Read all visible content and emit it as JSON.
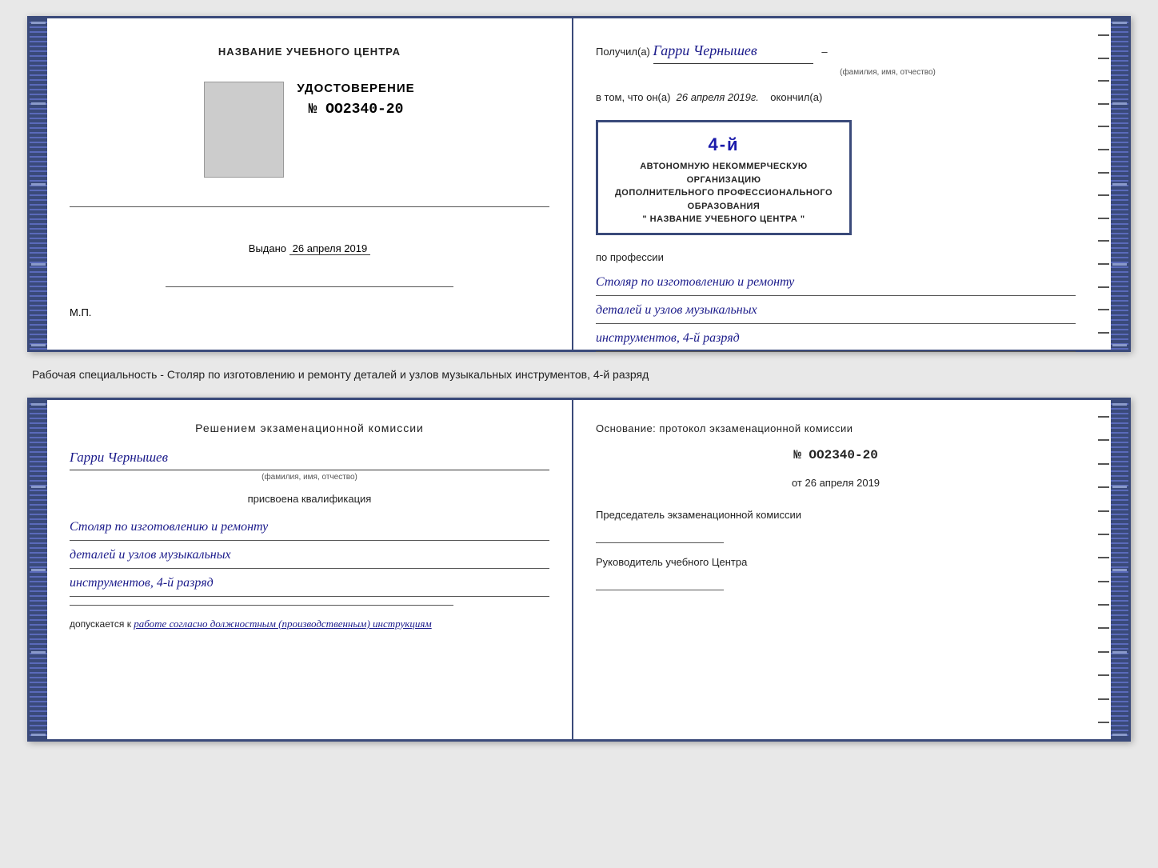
{
  "top_left": {
    "center_title": "НАЗВАНИЕ УЧЕБНОГО ЦЕНТРА",
    "cert_label": "УДОСТОВЕРЕНИЕ",
    "cert_number": "№ OO2340-20",
    "issued_label": "Выдано",
    "issued_date": "26 апреля 2019",
    "mp_label": "М.П."
  },
  "top_right": {
    "received_prefix": "Получил(а)",
    "recipient_name": "Гарри Чернышев",
    "name_sublabel": "(фамилия, имя, отчество)",
    "in_that_prefix": "в том, что он(а)",
    "date_text": "26 апреля 2019г.",
    "finished_label": "окончил(а)",
    "stamp_big": "4-й",
    "stamp_line1": "АВТОНОМНУЮ НЕКОММЕРЧЕСКУЮ ОРГАНИЗАЦИЮ",
    "stamp_line2": "ДОПОЛНИТЕЛЬНОГО ПРОФЕССИОНАЛЬНОГО ОБРАЗОВАНИЯ",
    "stamp_line3": "\" НАЗВАНИЕ УЧЕБНОГО ЦЕНТРА \"",
    "profession_label": "по профессии",
    "profession_line1": "Столяр по изготовлению и ремонту",
    "profession_line2": "деталей и узлов музыкальных",
    "profession_line3": "инструментов, 4-й разряд"
  },
  "caption": {
    "text": "Рабочая специальность - Столяр по изготовлению и ремонту деталей и узлов музыкальных инструментов, 4-й разряд"
  },
  "bottom_left": {
    "decision_title": "Решением экзаменационной комиссии",
    "person_name": "Гарри Чернышев",
    "name_sublabel": "(фамилия, имя, отчество)",
    "assigned_text": "присвоена квалификация",
    "qualification_line1": "Столяр по изготовлению и ремонту",
    "qualification_line2": "деталей и узлов музыкальных",
    "qualification_line3": "инструментов, 4-й разряд",
    "allowed_prefix": "допускается к",
    "allowed_italic": "работе согласно должностным (производственным) инструкциям"
  },
  "bottom_right": {
    "basis_title": "Основание: протокол экзаменационной комиссии",
    "protocol_number": "№ OO2340-20",
    "from_label": "от",
    "from_date": "26 апреля 2019",
    "chairman_title": "Председатель экзаменационной комиссии",
    "center_head_title": "Руководитель учебного Центра"
  }
}
